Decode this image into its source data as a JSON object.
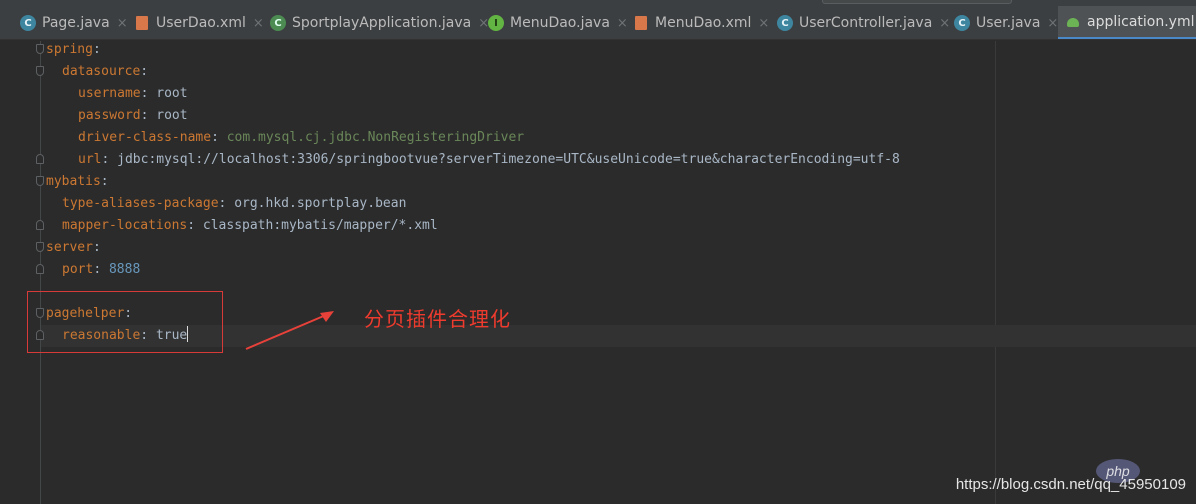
{
  "tabs": [
    {
      "label": "Page.java",
      "icon": "java-class-icon",
      "icon_letter": "C"
    },
    {
      "label": "UserDao.xml",
      "icon": "xml-file-icon",
      "icon_letter": ""
    },
    {
      "label": "SportplayApplication.java",
      "icon": "spring-boot-class-icon",
      "icon_letter": "C"
    },
    {
      "label": "MenuDao.java",
      "icon": "java-interface-icon",
      "icon_letter": "I"
    },
    {
      "label": "MenuDao.xml",
      "icon": "xml-file-icon",
      "icon_letter": ""
    },
    {
      "label": "UserController.java",
      "icon": "java-class-icon",
      "icon_letter": "C"
    },
    {
      "label": "User.java",
      "icon": "java-class-icon",
      "icon_letter": "C"
    },
    {
      "label": "application.yml",
      "icon": "yaml-file-icon",
      "icon_letter": "",
      "active": true
    }
  ],
  "close_glyph": "×",
  "code": [
    {
      "key": "spring",
      "sep": ":",
      "value": ""
    },
    {
      "key": "datasource",
      "sep": ":",
      "value": ""
    },
    {
      "key": "username",
      "sep": ": ",
      "value": "root"
    },
    {
      "key": "password",
      "sep": ": ",
      "value": "root"
    },
    {
      "key": "driver-class-name",
      "sep": ": ",
      "value": "com.mysql.cj.jdbc.NonRegisteringDriver"
    },
    {
      "key": "url",
      "sep": ": ",
      "value": "jdbc:mysql://localhost:3306/springbootvue?serverTimezone=UTC&useUnicode=true&characterEncoding=utf-8"
    },
    {
      "key": "mybatis",
      "sep": ":",
      "value": ""
    },
    {
      "key": "type-aliases-package",
      "sep": ": ",
      "value": "org.hkd.sportplay.bean"
    },
    {
      "key": "mapper-locations",
      "sep": ": ",
      "value": "classpath:mybatis/mapper/*.xml"
    },
    {
      "key": "server",
      "sep": ":",
      "value": ""
    },
    {
      "key": "port",
      "sep": ": ",
      "value": "8888"
    },
    {
      "key": "pagehelper",
      "sep": ":",
      "value": ""
    },
    {
      "key": "reasonable",
      "sep": ": ",
      "value": "true"
    }
  ],
  "annotation": {
    "text": "分页插件合理化",
    "color": "#ee3b2e"
  },
  "watermark": {
    "text": "https://blog.csdn.net/qq_45950109",
    "logo": "php"
  },
  "colors": {
    "key": "#cc7832",
    "string": "#6a8759",
    "number": "#6897bb",
    "text": "#a9b7c6",
    "active_tab_underline": "#4a88c7"
  }
}
